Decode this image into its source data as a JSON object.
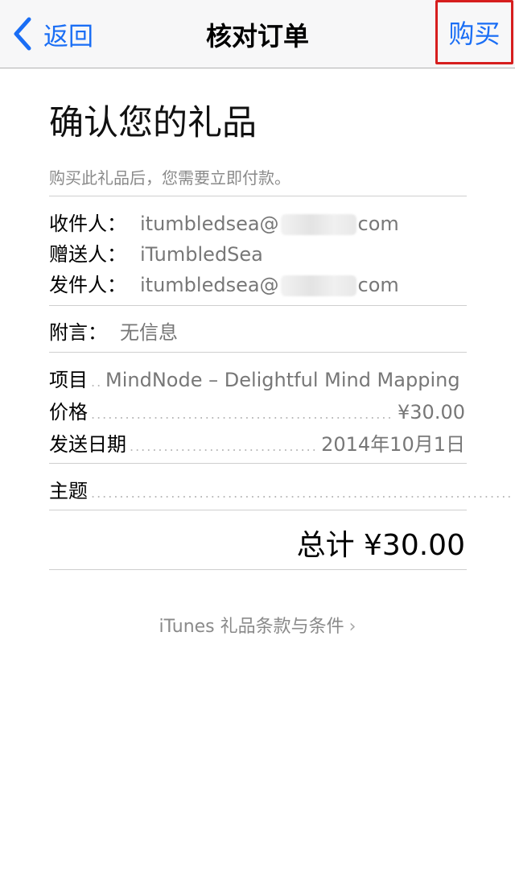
{
  "navbar": {
    "back_label": "返回",
    "title": "核对订单",
    "buy_label": "购买"
  },
  "heading": "确认您的礼品",
  "notice": "购买此礼品后，您需要立即付款。",
  "recipients": {
    "to_label": "收件人：",
    "to_value_prefix": "itumbledsea@",
    "to_value_suffix": "com",
    "from_label": "赠送人：",
    "from_value": "iTumbledSea",
    "sender_label": "发件人：",
    "sender_value_prefix": "itumbledsea@",
    "sender_value_suffix": "com"
  },
  "message": {
    "label": "附言：",
    "value": "无信息"
  },
  "details": {
    "item_label": "项目",
    "item_value": "MindNode – Delightful Mind Mapping",
    "price_label": "价格",
    "price_value": "¥30.00",
    "date_label": "发送日期",
    "date_value": "2014年10月1日",
    "subject_label": "主题"
  },
  "total": "总计 ¥30.00",
  "terms": {
    "label": "iTunes 礼品条款与条件",
    "chevron": "›"
  },
  "colors": {
    "accent": "#1a6ef5",
    "highlight_border": "#d61e1e"
  }
}
